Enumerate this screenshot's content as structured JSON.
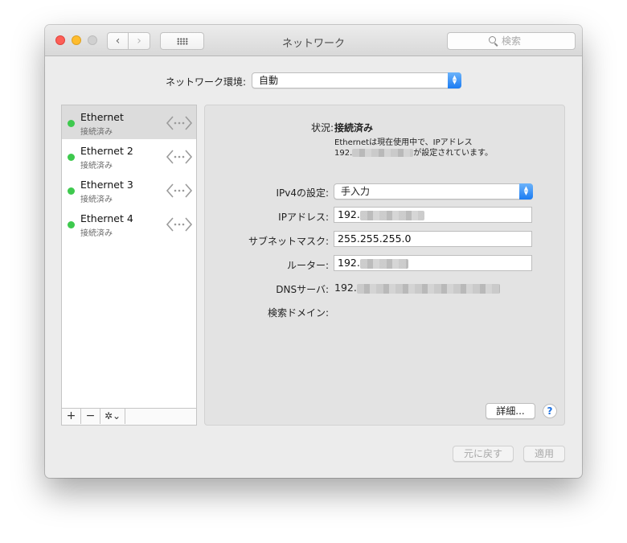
{
  "window": {
    "title": "ネットワーク",
    "search_placeholder": "検索",
    "back_glyph": "‹",
    "forward_glyph": "›"
  },
  "location": {
    "label": "ネットワーク環境:",
    "value": "自動"
  },
  "services": [
    {
      "name": "Ethernet",
      "status": "接続済み",
      "selected": true
    },
    {
      "name": "Ethernet 2",
      "status": "接続済み",
      "selected": false
    },
    {
      "name": "Ethernet 3",
      "status": "接続済み",
      "selected": false
    },
    {
      "name": "Ethernet 4",
      "status": "接続済み",
      "selected": false
    }
  ],
  "sidebar_controls": {
    "add": "+",
    "remove": "−",
    "gear": "✲⌄"
  },
  "detail": {
    "status_label": "状況:",
    "status_value": "接続済み",
    "desc_line1": "Ethernetは現在使用中で、IPアドレス",
    "desc_prefix": "192.",
    "desc_suffix": "が設定されています。",
    "ipv4_label": "IPv4の設定:",
    "ipv4_value": "手入力",
    "ip_label": "IPアドレス:",
    "ip_prefix": "192.",
    "subnet_label": "サブネットマスク:",
    "subnet_value": "255.255.255.0",
    "router_label": "ルーター:",
    "router_prefix": "192.",
    "dns_label": "DNSサーバ:",
    "dns_prefix": "192.",
    "search_domain_label": "検索ドメイン:",
    "advanced_button": "詳細...",
    "help_button": "?"
  },
  "footer": {
    "revert_button": "元に戻す",
    "apply_button": "適用"
  },
  "colors": {
    "status_green": "#3ec94e",
    "popup_blue": "#1b7cf3",
    "close_red": "#fd5f57",
    "minimize_yellow": "#febc2e"
  }
}
